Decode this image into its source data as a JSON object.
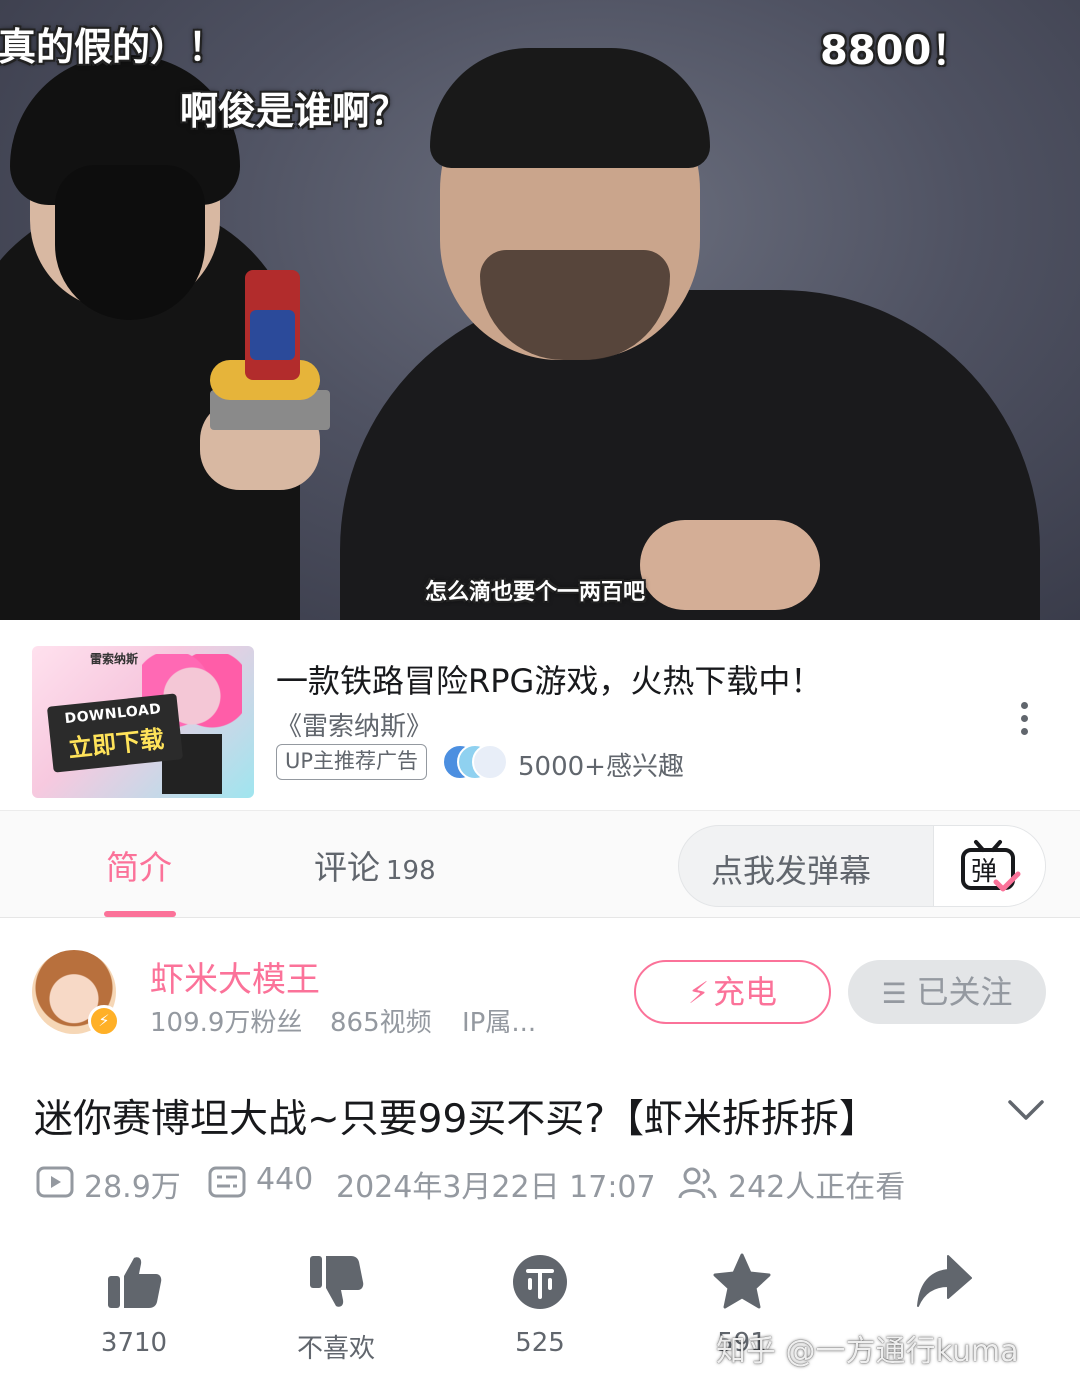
{
  "video": {
    "subtitles": {
      "top_left": "真的假的）！",
      "mid_left": "啊俊是谁啊？",
      "top_right": "8800！",
      "caption": "怎么滴也要个一两百吧"
    }
  },
  "ad": {
    "thumb_brand": "雷索纳斯",
    "thumb_download_en": "DOWNLOAD",
    "thumb_download_cn": "立即下载",
    "title": "一款铁路冒险RPG游戏，火热下载中！",
    "subtitle": "《雷索纳斯》",
    "tag": "UP主推荐广告",
    "interest": "5000+感兴趣"
  },
  "tabs": {
    "intro": "简介",
    "comment": "评论",
    "comment_count": "198",
    "danmaku_placeholder": "点我发弹幕",
    "danmaku_icon_char": "弹"
  },
  "uploader": {
    "name": "虾米大模王",
    "fans": "109.9万粉丝",
    "videos": "865视频",
    "ip": "IP属...",
    "charge_label": "充电",
    "follow_label": "已关注"
  },
  "title": "迷你赛博坦大战~只要99买不买?【虾米拆拆拆】",
  "stats": {
    "views": "28.9万",
    "danmaku": "440",
    "date": "2024年3月22日 17:07",
    "watching": "242人正在看"
  },
  "actions": {
    "like": "3710",
    "dislike": "不喜欢",
    "coin": "525",
    "favorite": "591",
    "share": ""
  },
  "watermark": "知乎 @一方通行kuma",
  "colors": {
    "accent": "#fb7299",
    "text_primary": "#18191c",
    "text_secondary": "#61666d",
    "text_tertiary": "#9499a0",
    "icon": "#61666d"
  }
}
